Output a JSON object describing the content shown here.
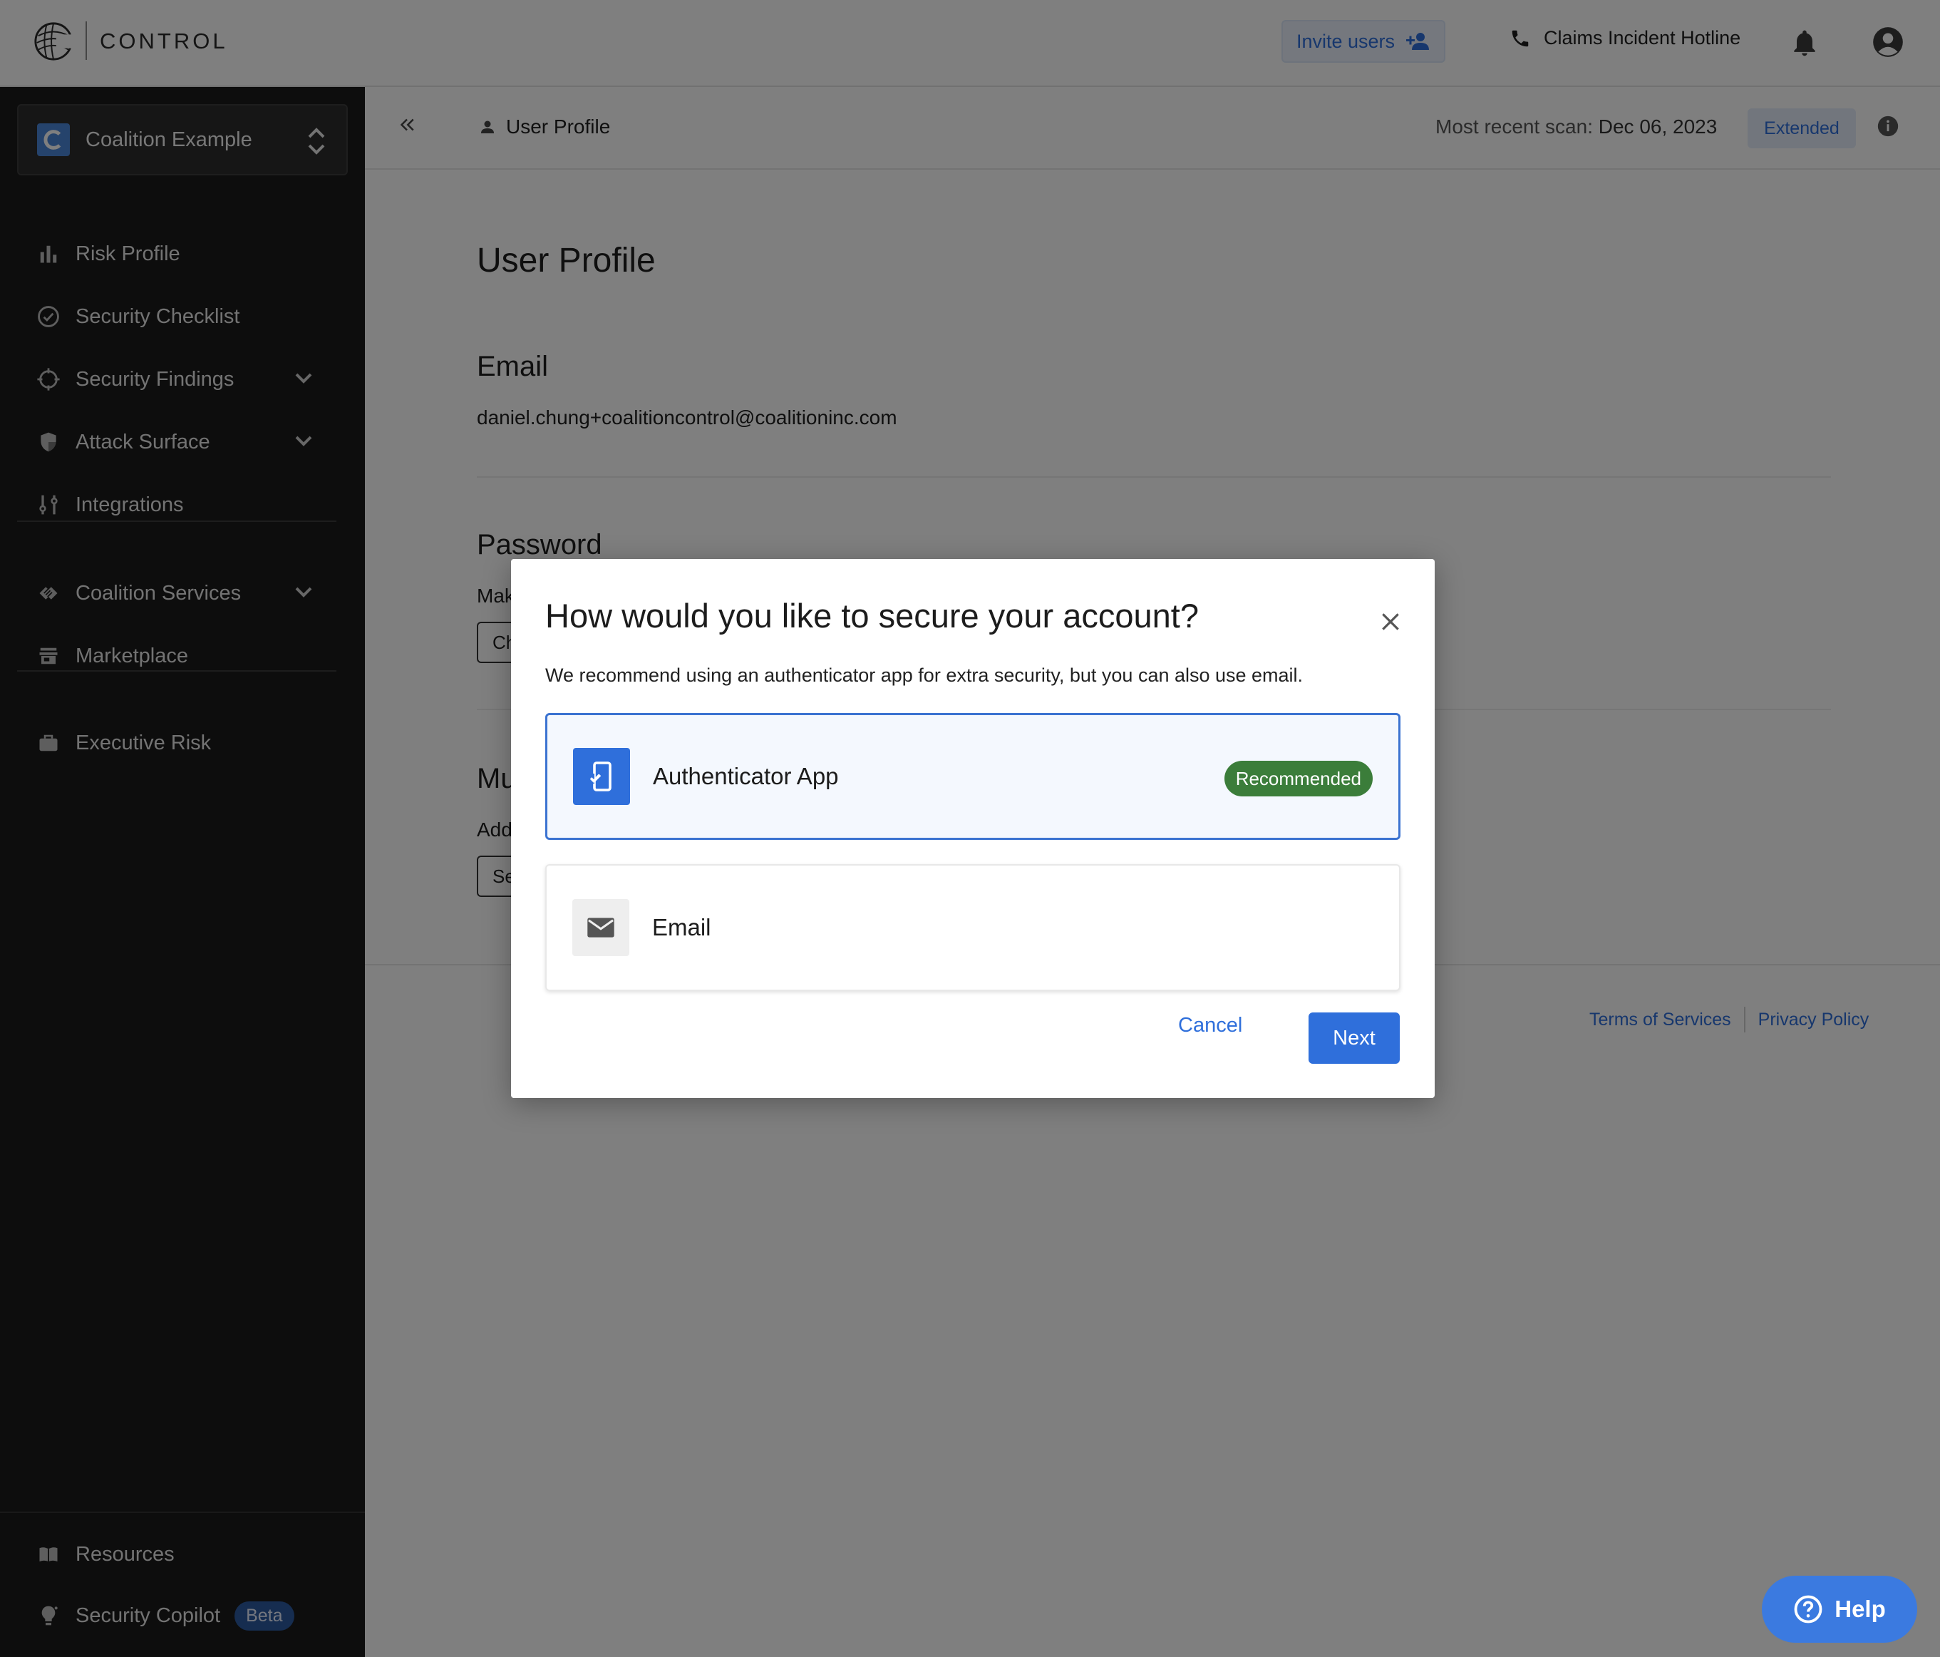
{
  "header": {
    "app_name": "CONTROL",
    "invite_label": "Invite users",
    "hotline_label": "Claims Incident Hotline"
  },
  "sidebar": {
    "org_name": "Coalition Example",
    "items": [
      {
        "label": "Risk Profile",
        "icon": "bar-chart-icon"
      },
      {
        "label": "Security Checklist",
        "icon": "check-circle-icon"
      },
      {
        "label": "Security Findings",
        "icon": "crosshair-icon",
        "expandable": true
      },
      {
        "label": "Attack Surface",
        "icon": "shield-icon",
        "expandable": true
      },
      {
        "label": "Integrations",
        "icon": "integrations-icon"
      },
      {
        "label": "Coalition Services",
        "icon": "services-icon",
        "expandable": true
      },
      {
        "label": "Marketplace",
        "icon": "store-icon"
      },
      {
        "label": "Executive Risk",
        "icon": "briefcase-icon"
      }
    ],
    "bottom": {
      "resources_label": "Resources",
      "copilot_label": "Security Copilot",
      "beta_label": "Beta"
    }
  },
  "breadcrumb": {
    "label": "User Profile",
    "scan_prefix": "Most recent scan:",
    "scan_date": "Dec 06, 2023",
    "scan_badge": "Extended"
  },
  "profile": {
    "title": "User Profile",
    "email_heading": "Email",
    "email_value": "daniel.chung+coalitioncontrol@coalitioninc.com",
    "password_heading": "Password",
    "password_text_visible": "Mak",
    "password_button_visible": "Ch",
    "mfa_heading_visible": "Mu",
    "mfa_text_visible": "Add",
    "mfa_button_visible": "Se"
  },
  "footer": {
    "terms": "Terms of Services",
    "privacy": "Privacy Policy"
  },
  "modal": {
    "title": "How would you like to secure your account?",
    "description": "We recommend using an authenticator app for extra security, but you can also use email.",
    "options": [
      {
        "label": "Authenticator App",
        "badge": "Recommended",
        "selected": true,
        "icon": "phone-check-icon"
      },
      {
        "label": "Email",
        "selected": false,
        "icon": "mail-icon"
      }
    ],
    "cancel_label": "Cancel",
    "next_label": "Next"
  },
  "help": {
    "label": "Help"
  },
  "colors": {
    "accent": "#2f6fdb",
    "sidebar_bg": "#1b1b1b",
    "recommended": "#3b7d3a"
  }
}
